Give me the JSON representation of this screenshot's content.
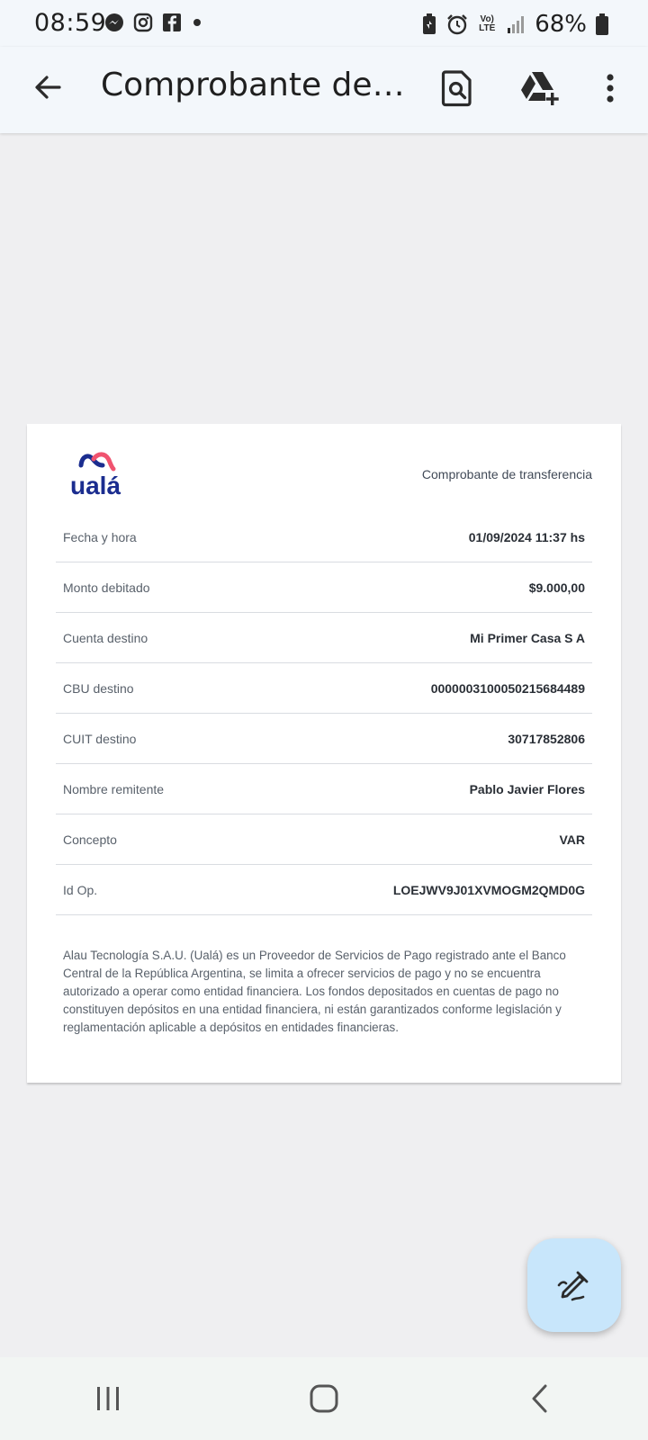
{
  "status_bar": {
    "time": "08:59",
    "battery": "68%",
    "network": "Vo) LTE",
    "left_icons": [
      "messenger-icon",
      "instagram-icon",
      "facebook-icon",
      "dot-icon"
    ],
    "right_icons": [
      "battery-saver-icon",
      "alarm-icon",
      "volte-icon",
      "signal-icon",
      "battery-icon"
    ]
  },
  "app_bar": {
    "title": "Comprobante de transferencia",
    "actions": [
      "find-in-document-icon",
      "add-to-drive-icon",
      "more-options-icon"
    ]
  },
  "document": {
    "brand": "ualá",
    "heading": "Comprobante de transferencia",
    "rows": [
      {
        "label": "Fecha y hora",
        "value": "01/09/2024 11:37 hs"
      },
      {
        "label": "Monto debitado",
        "value": "$9.000,00"
      },
      {
        "label": "Cuenta destino",
        "value": "Mi Primer Casa S A"
      },
      {
        "label": "CBU destino",
        "value": "0000003100050215684489"
      },
      {
        "label": "CUIT destino",
        "value": "30717852806"
      },
      {
        "label": "Nombre remitente",
        "value": "Pablo Javier Flores"
      },
      {
        "label": "Concepto",
        "value": "VAR"
      },
      {
        "label": "Id Op.",
        "value": "LOEJWV9J01XVMOGM2QMD0G"
      }
    ],
    "disclaimer": "Alau Tecnología S.A.U. (Ualá) es un Proveedor de Servicios de Pago registrado ante el Banco Central de la República Argentina, se limita a ofrecer servicios de pago y no se encuentra autorizado a operar como entidad financiera. Los fondos depositados en cuentas de pago no constituyen depósitos en una entidad financiera, ni están garantizados conforme legislación y reglamentación aplicable a depósitos en entidades financieras."
  },
  "fab": {
    "icon": "edit-pen-icon"
  },
  "nav_bar": {
    "buttons": [
      "recents-icon",
      "home-icon",
      "back-icon"
    ]
  },
  "colors": {
    "brand_blue": "#1b2d8f",
    "brand_pink": "#f0536f",
    "fab_bg": "#c8e6fb",
    "page_bg": "#efeff1"
  }
}
